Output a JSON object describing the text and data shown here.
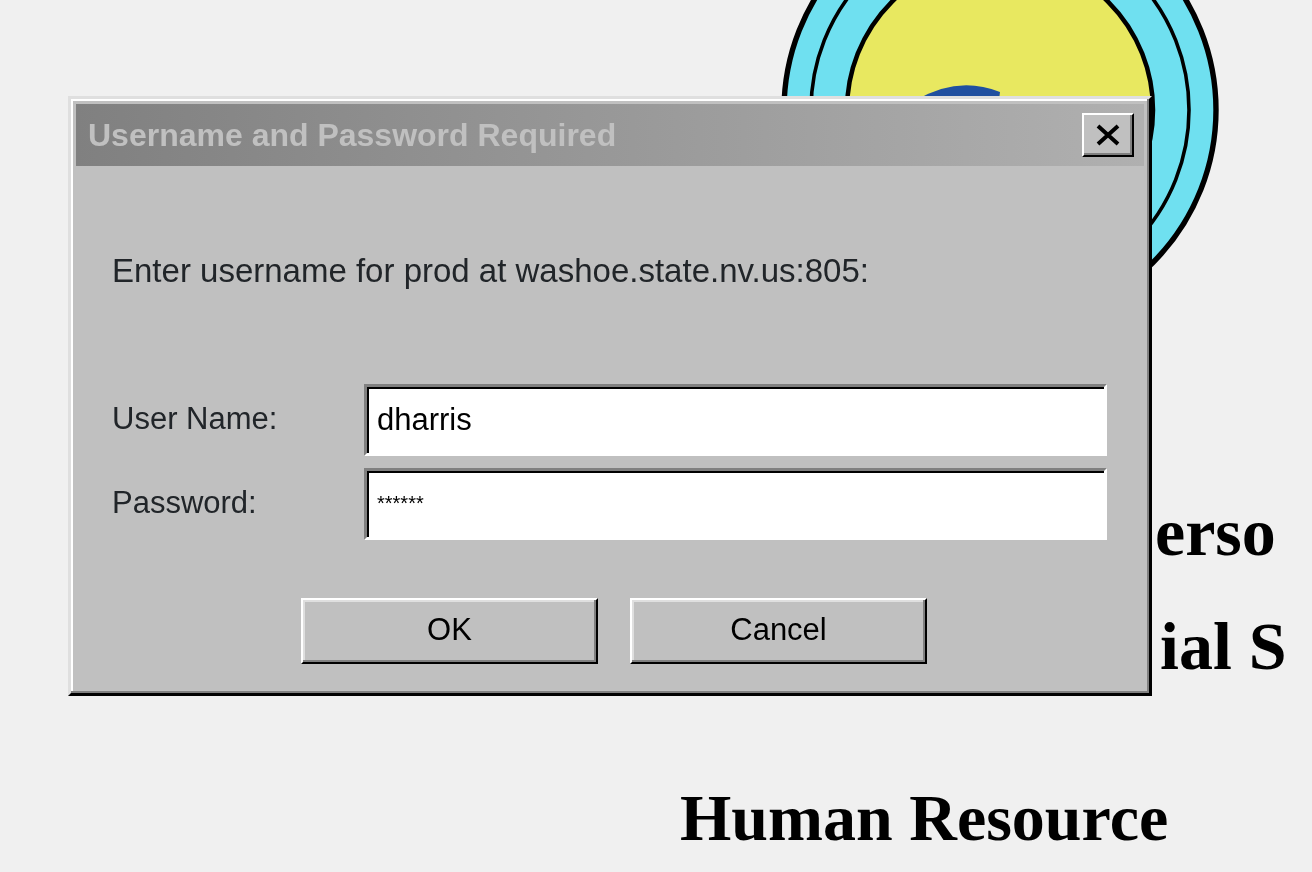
{
  "background_page": {
    "headings": [
      {
        "text": "erso"
      },
      {
        "text": "ial S"
      },
      {
        "text": "Human Resource"
      }
    ]
  },
  "dialog": {
    "title": "Username and Password Required",
    "active": false,
    "message": "Enter username for prod at washoe.state.nv.us:805:",
    "fields": [
      {
        "label": "User Name:",
        "value": "dharris",
        "kind": "text"
      },
      {
        "label": "Password:",
        "value": "******",
        "kind": "password"
      }
    ],
    "buttons": [
      "OK",
      "Cancel"
    ]
  }
}
